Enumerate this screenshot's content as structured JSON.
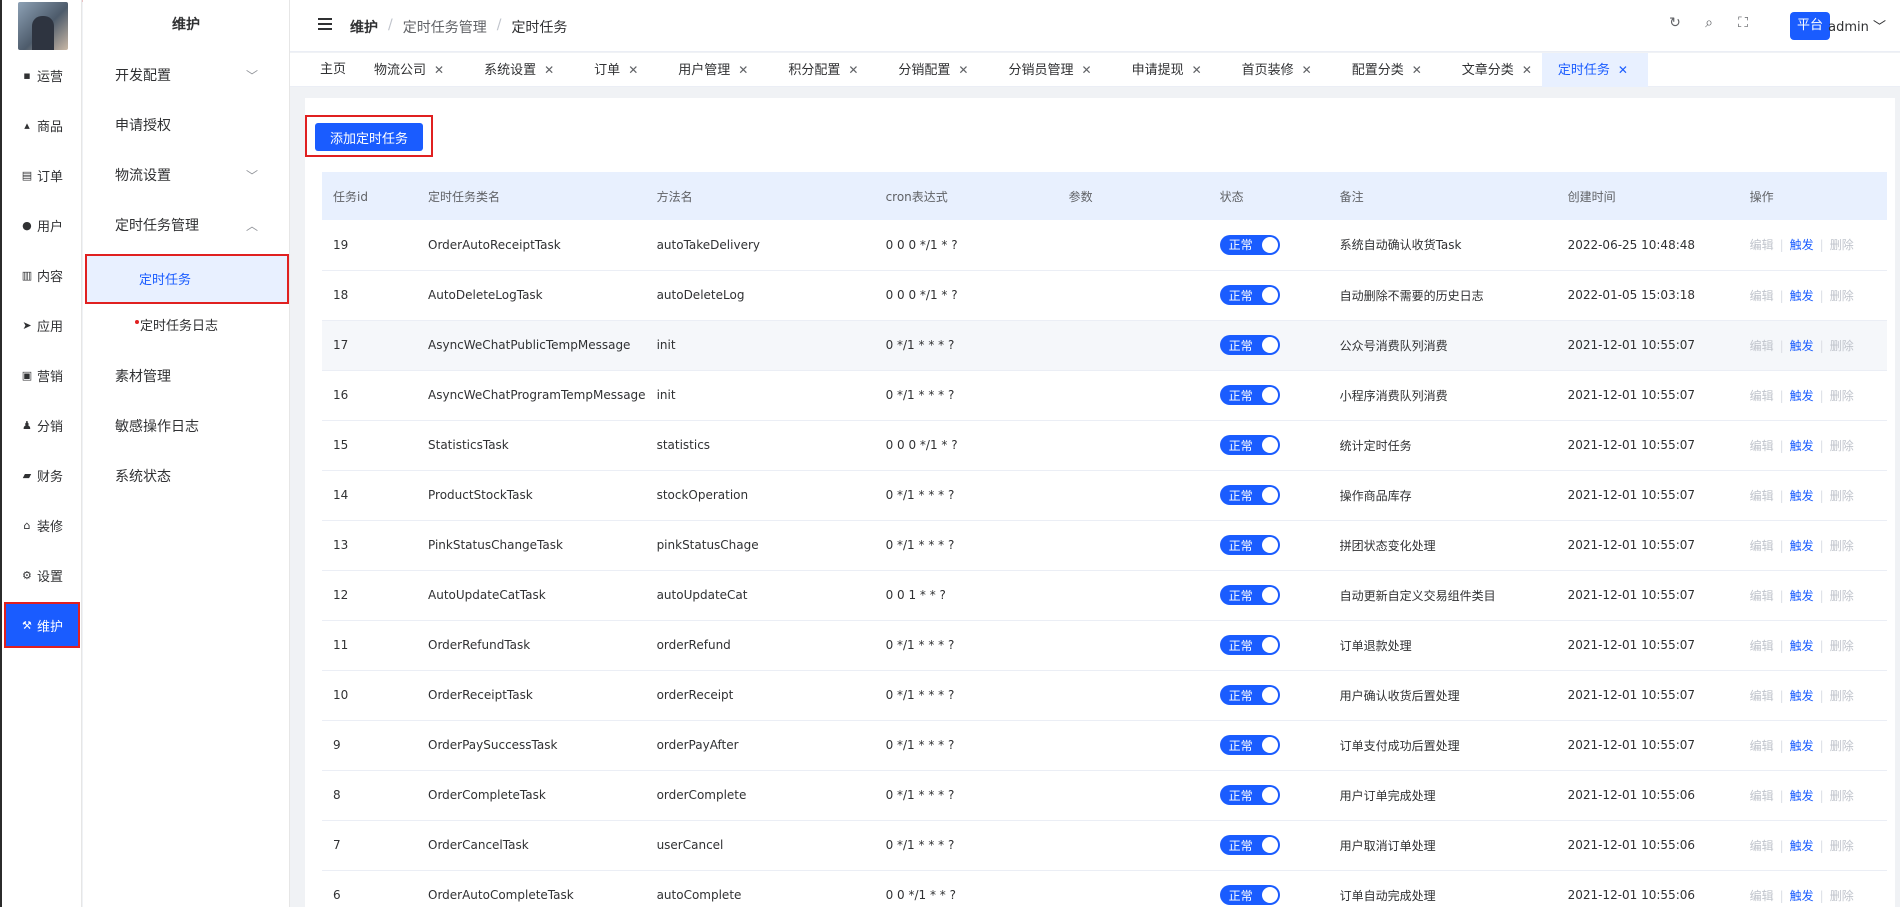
{
  "rail": {
    "items": [
      {
        "label": "运营",
        "icon": "grid-icon"
      },
      {
        "label": "商品",
        "icon": "bag-icon"
      },
      {
        "label": "订单",
        "icon": "clipboard-icon"
      },
      {
        "label": "用户",
        "icon": "user-icon"
      },
      {
        "label": "内容",
        "icon": "chart-icon"
      },
      {
        "label": "应用",
        "icon": "send-icon"
      },
      {
        "label": "营销",
        "icon": "marketing-icon"
      },
      {
        "label": "分销",
        "icon": "share-user-icon"
      },
      {
        "label": "财务",
        "icon": "wallet-icon"
      },
      {
        "label": "装修",
        "icon": "home-icon"
      },
      {
        "label": "设置",
        "icon": "gear-icon"
      },
      {
        "label": "维护",
        "icon": "tool-icon"
      }
    ]
  },
  "submenu": {
    "title": "维护",
    "items": [
      {
        "label": "开发配置"
      },
      {
        "label": "申请授权"
      },
      {
        "label": "物流设置"
      },
      {
        "label": "定时任务管理"
      },
      {
        "label": "定时任务"
      },
      {
        "label": "定时任务日志"
      },
      {
        "label": "素材管理"
      },
      {
        "label": "敏感操作日志"
      },
      {
        "label": "系统状态"
      }
    ]
  },
  "header": {
    "breadcrumb": [
      "维护",
      "定时任务管理",
      "定时任务"
    ],
    "platform_label": "平台",
    "user_name": "admin"
  },
  "tabs": [
    {
      "label": "主页"
    },
    {
      "label": "物流公司"
    },
    {
      "label": "系统设置"
    },
    {
      "label": "订单"
    },
    {
      "label": "用户管理"
    },
    {
      "label": "积分配置"
    },
    {
      "label": "分销配置"
    },
    {
      "label": "分销员管理"
    },
    {
      "label": "申请提现"
    },
    {
      "label": "首页装修"
    },
    {
      "label": "配置分类"
    },
    {
      "label": "文章分类"
    },
    {
      "label": "定时任务"
    }
  ],
  "toolbar": {
    "add_label": "添加定时任务"
  },
  "table": {
    "columns": [
      "任务id",
      "定时任务类名",
      "方法名",
      "cron表达式",
      "参数",
      "状态",
      "备注",
      "创建时间",
      "操作"
    ],
    "status_label": "正常",
    "ops": {
      "edit": "编辑",
      "run": "触发",
      "delete": "删除"
    },
    "rows": [
      {
        "id": "19",
        "cls": "OrderAutoReceiptTask",
        "method": "autoTakeDelivery",
        "cron": "0 0 0 */1 * ?",
        "param": "",
        "remark": "系统自动确认收货Task",
        "time": "2022-06-25 10:48:48"
      },
      {
        "id": "18",
        "cls": "AutoDeleteLogTask",
        "method": "autoDeleteLog",
        "cron": "0 0 0 */1 * ?",
        "param": "",
        "remark": "自动删除不需要的历史日志",
        "time": "2022-01-05 15:03:18"
      },
      {
        "id": "17",
        "cls": "AsyncWeChatPublicTempMessage",
        "method": "init",
        "cron": "0 */1 * * * ?",
        "param": "",
        "remark": "公众号消费队列消费",
        "time": "2021-12-01 10:55:07"
      },
      {
        "id": "16",
        "cls": "AsyncWeChatProgramTempMessage",
        "method": "init",
        "cron": "0 */1 * * * ?",
        "param": "",
        "remark": "小程序消费队列消费",
        "time": "2021-12-01 10:55:07"
      },
      {
        "id": "15",
        "cls": "StatisticsTask",
        "method": "statistics",
        "cron": "0 0 0 */1 * ?",
        "param": "",
        "remark": "统计定时任务",
        "time": "2021-12-01 10:55:07"
      },
      {
        "id": "14",
        "cls": "ProductStockTask",
        "method": "stockOperation",
        "cron": "0 */1 * * * ?",
        "param": "",
        "remark": "操作商品库存",
        "time": "2021-12-01 10:55:07"
      },
      {
        "id": "13",
        "cls": "PinkStatusChangeTask",
        "method": "pinkStatusChage",
        "cron": "0 */1 * * * ?",
        "param": "",
        "remark": "拼团状态变化处理",
        "time": "2021-12-01 10:55:07"
      },
      {
        "id": "12",
        "cls": "AutoUpdateCatTask",
        "method": "autoUpdateCat",
        "cron": "0 0 1 * * ?",
        "param": "",
        "remark": "自动更新自定义交易组件类目",
        "time": "2021-12-01 10:55:07"
      },
      {
        "id": "11",
        "cls": "OrderRefundTask",
        "method": "orderRefund",
        "cron": "0 */1 * * * ?",
        "param": "",
        "remark": "订单退款处理",
        "time": "2021-12-01 10:55:07"
      },
      {
        "id": "10",
        "cls": "OrderReceiptTask",
        "method": "orderReceipt",
        "cron": "0 */1 * * * ?",
        "param": "",
        "remark": "用户确认收货后置处理",
        "time": "2021-12-01 10:55:07"
      },
      {
        "id": "9",
        "cls": "OrderPaySuccessTask",
        "method": "orderPayAfter",
        "cron": "0 */1 * * * ?",
        "param": "",
        "remark": "订单支付成功后置处理",
        "time": "2021-12-01 10:55:07"
      },
      {
        "id": "8",
        "cls": "OrderCompleteTask",
        "method": "orderComplete",
        "cron": "0 */1 * * * ?",
        "param": "",
        "remark": "用户订单完成处理",
        "time": "2021-12-01 10:55:06"
      },
      {
        "id": "7",
        "cls": "OrderCancelTask",
        "method": "userCancel",
        "cron": "0 */1 * * * ?",
        "param": "",
        "remark": "用户取消订单处理",
        "time": "2021-12-01 10:55:06"
      },
      {
        "id": "6",
        "cls": "OrderAutoCompleteTask",
        "method": "autoComplete",
        "cron": "0 0 */1 * * ?",
        "param": "",
        "remark": "订单自动完成处理",
        "time": "2021-12-01 10:55:06"
      }
    ]
  }
}
